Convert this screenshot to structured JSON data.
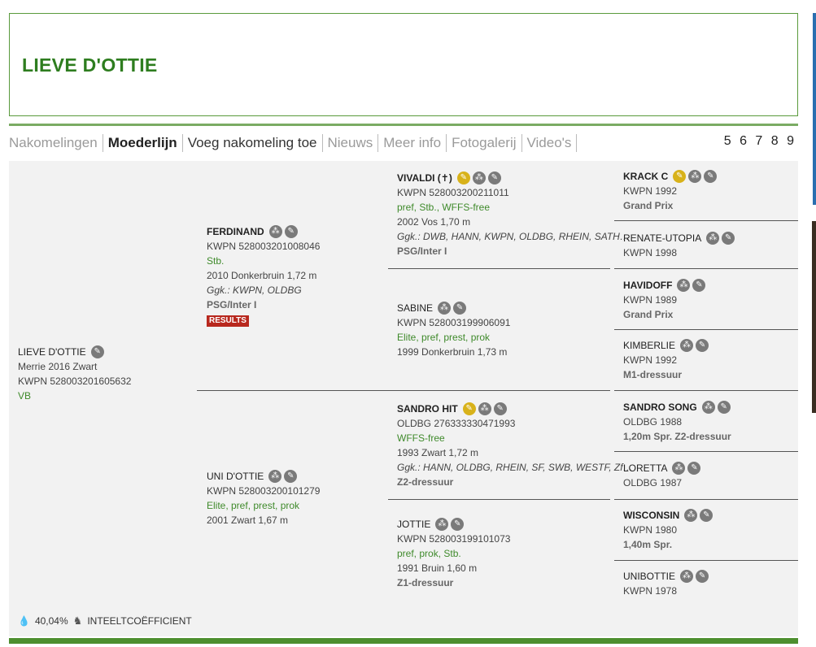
{
  "page_title": "LIEVE D'OTTIE",
  "tabs": [
    {
      "label": "Nakomelingen"
    },
    {
      "label": "Moederlijn"
    },
    {
      "label": "Voeg nakomeling toe"
    },
    {
      "label": "Nieuws"
    },
    {
      "label": "Meer info"
    },
    {
      "label": "Fotogalerij"
    },
    {
      "label": "Video's"
    }
  ],
  "pagination": "5 6 7 8 9",
  "subject": {
    "name": "LIEVE D'OTTIE",
    "line1": "Merrie 2016 Zwart",
    "line2": "KWPN 528003201605632",
    "predicate": "VB"
  },
  "sire": {
    "name": "FERDINAND",
    "reg": "KWPN 528003201008046",
    "predicates": "Stb.",
    "info": "2010 Donkerbruin 1,72 m",
    "ggk": "Ggk.: KWPN, OLDBG",
    "discipline": "PSG/Inter I",
    "badge": "RESULTS"
  },
  "dam": {
    "name": "UNI D'OTTIE",
    "reg": "KWPN 528003200101279",
    "predicates": "Elite, pref, prest, prok",
    "info": "2001 Zwart 1,67 m"
  },
  "ss": {
    "name": "VIVALDI (✝)",
    "reg": "KWPN 528003200211011",
    "predicates": "pref, Stb., WFFS-free",
    "info": "2002 Vos 1,70 m",
    "ggk": "Ggk.: DWB, HANN, KWPN, OLDBG, RHEIN, SATH…",
    "discipline": "PSG/Inter I"
  },
  "sd": {
    "name": "SABINE",
    "reg": "KWPN 528003199906091",
    "predicates": "Elite, pref, prest, prok",
    "info": "1999 Donkerbruin 1,73 m"
  },
  "ds": {
    "name": "SANDRO HIT",
    "reg": "OLDBG 276333330471993",
    "predicates": "WFFS-free",
    "info": "1993 Zwart 1,72 m",
    "ggk": "Ggk.: HANN, OLDBG, RHEIN, SF, SWB, WESTF, Zf…",
    "discipline": "Z2-dressuur"
  },
  "dd": {
    "name": "JOTTIE",
    "reg": "KWPN 528003199101073",
    "predicates": "pref, prok, Stb.",
    "info": "1991 Bruin 1,60 m",
    "discipline": "Z1-dressuur"
  },
  "g": [
    {
      "name": "KRACK C",
      "reg": "KWPN 1992",
      "discipline": "Grand Prix"
    },
    {
      "name": "RENATE-UTOPIA",
      "reg": "KWPN 1998",
      "discipline": ""
    },
    {
      "name": "HAVIDOFF",
      "reg": "KWPN 1989",
      "discipline": "Grand Prix"
    },
    {
      "name": "KIMBERLIE",
      "reg": "KWPN 1992",
      "discipline": "M1-dressuur"
    },
    {
      "name": "SANDRO SONG",
      "reg": "OLDBG 1988",
      "discipline": "1,20m Spr. Z2-dressuur"
    },
    {
      "name": "LORETTA",
      "reg": "OLDBG 1987",
      "discipline": ""
    },
    {
      "name": "WISCONSIN",
      "reg": "KWPN 1980",
      "discipline": "1,40m Spr."
    },
    {
      "name": "UNIBOTTIE",
      "reg": "KWPN 1978",
      "discipline": ""
    }
  ],
  "footer": {
    "inbreeding_value": "40,04%",
    "inbreeding_label": "INTEELTCOËFFICIENT"
  },
  "icons": {
    "pedigree": "pedigree-icon",
    "edit": "pencil-icon",
    "medal": "medal-icon",
    "drop": "drop-icon",
    "horse": "horse-icon"
  },
  "colors": {
    "accent_green": "#2e7d1f",
    "results_red": "#b8281e",
    "medal_gold": "#d8b21a"
  }
}
